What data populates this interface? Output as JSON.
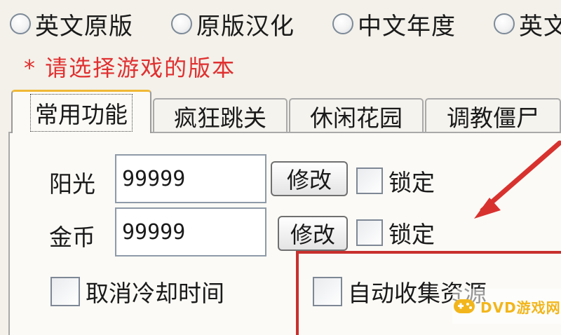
{
  "versions": {
    "options": [
      {
        "label": "英文原版"
      },
      {
        "label": "原版汉化"
      },
      {
        "label": "中文年度"
      },
      {
        "label": "英文"
      }
    ]
  },
  "hint": "* 请选择游戏的版本",
  "tabs": [
    {
      "label": "常用功能",
      "active": true
    },
    {
      "label": "疯狂跳关",
      "active": false
    },
    {
      "label": "休闲花园",
      "active": false
    },
    {
      "label": "调教僵尸",
      "active": false
    }
  ],
  "fields": {
    "sun": {
      "label": "阳光",
      "value": "99999",
      "button": "修改",
      "lock": "锁定"
    },
    "coin": {
      "label": "金币",
      "value": "99999",
      "button": "修改",
      "lock": "锁定"
    }
  },
  "options": {
    "no_cooldown": "取消冷却时间",
    "auto_collect": "自动收集资源"
  },
  "watermark": {
    "text": "DVD游戏网"
  },
  "colors": {
    "hint": "#e03030",
    "highlight": "#c8302d",
    "active_tab_accent": "#f0b836",
    "watermark": "#f2b61c"
  }
}
